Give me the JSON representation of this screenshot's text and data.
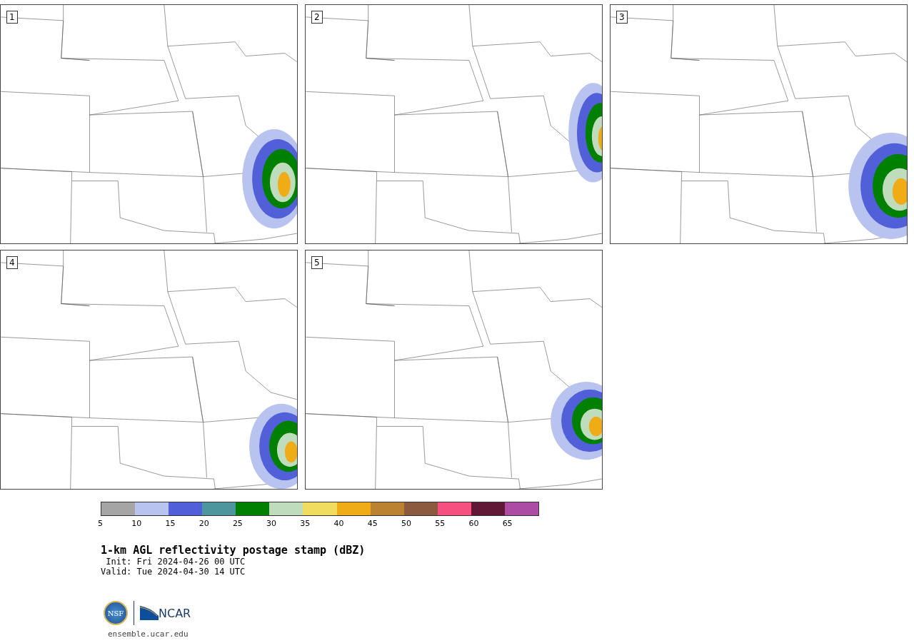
{
  "panels": [
    {
      "label": "1"
    },
    {
      "label": "2"
    },
    {
      "label": "3"
    },
    {
      "label": "4"
    },
    {
      "label": "5"
    }
  ],
  "colorbar": {
    "bins": [
      {
        "color": "#a5a5a5"
      },
      {
        "color": "#b8c3f0"
      },
      {
        "color": "#5160d8"
      },
      {
        "color": "#4e969e"
      },
      {
        "color": "#008000"
      },
      {
        "color": "#bfddbd"
      },
      {
        "color": "#f0dc5e"
      },
      {
        "color": "#f0ac17"
      },
      {
        "color": "#bb8232"
      },
      {
        "color": "#8b5a3f"
      },
      {
        "color": "#f5507f"
      },
      {
        "color": "#611837"
      },
      {
        "color": "#ad4ca5"
      }
    ],
    "ticks": [
      "5",
      "10",
      "15",
      "20",
      "25",
      "30",
      "35",
      "40",
      "45",
      "50",
      "55",
      "60",
      "65"
    ]
  },
  "title": "1-km AGL reflectivity postage stamp (dBZ)",
  "init": " Init: Fri 2024-04-26 00 UTC",
  "valid": "Valid: Tue 2024-04-30 14 UTC",
  "logos": {
    "nsf": "NSF",
    "ncar": "NCAR"
  },
  "url": "ensemble.ucar.edu"
}
